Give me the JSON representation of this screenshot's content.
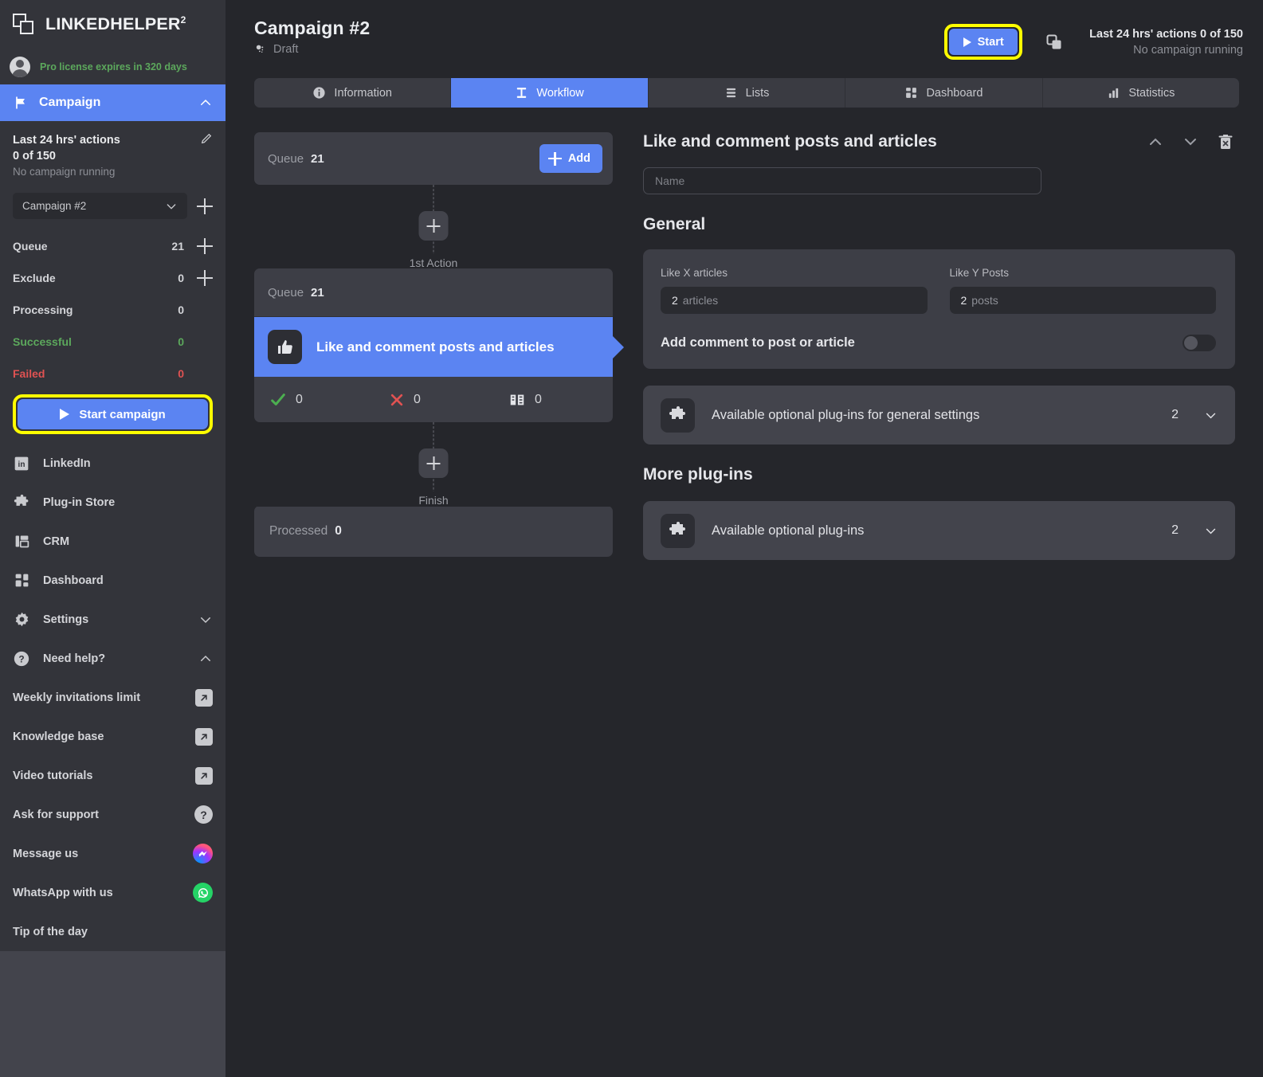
{
  "brand": {
    "name": "LINKEDHELPER",
    "sup": "2"
  },
  "license": {
    "text": "Pro license expires in 320 days",
    "color": "#5ca85c"
  },
  "sidebar": {
    "campaign_header": {
      "label": "Campaign",
      "icon": "flag-icon",
      "chevron": "chevron-up-icon"
    },
    "stats_header": {
      "title": "Last 24 hrs' actions",
      "value": "0 of 150",
      "subtitle": "No campaign running"
    },
    "campaign_select": {
      "value": "Campaign #2"
    },
    "counters": [
      {
        "label": "Queue",
        "value": "21",
        "has_add": true,
        "color": "default"
      },
      {
        "label": "Exclude",
        "value": "0",
        "has_add": true,
        "color": "default"
      },
      {
        "label": "Processing",
        "value": "0",
        "has_add": false,
        "color": "default"
      },
      {
        "label": "Successful",
        "value": "0",
        "has_add": false,
        "color": "green"
      },
      {
        "label": "Failed",
        "value": "0",
        "has_add": false,
        "color": "red"
      }
    ],
    "start_campaign_label": "Start campaign",
    "nav": [
      {
        "label": "LinkedIn",
        "icon": "linkedin-icon"
      },
      {
        "label": "Plug-in Store",
        "icon": "puzzle-icon"
      },
      {
        "label": "CRM",
        "icon": "crm-icon"
      },
      {
        "label": "Dashboard",
        "icon": "dashboard-icon"
      },
      {
        "label": "Settings",
        "icon": "gear-icon",
        "chevron": "chevron-down-icon"
      },
      {
        "label": "Need help?",
        "icon": "question-circle-icon",
        "chevron": "chevron-up-icon"
      }
    ],
    "links": [
      {
        "label": "Weekly invitations limit",
        "icon": "external-link-icon"
      },
      {
        "label": "Knowledge base",
        "icon": "external-link-icon"
      },
      {
        "label": "Video tutorials",
        "icon": "external-link-icon"
      },
      {
        "label": "Ask for support",
        "icon": "question-mark-icon"
      },
      {
        "label": "Message us",
        "icon": "messenger-icon"
      },
      {
        "label": "WhatsApp with us",
        "icon": "whatsapp-icon"
      },
      {
        "label": "Tip of the day",
        "icon": "none"
      }
    ]
  },
  "header": {
    "title": "Campaign #2",
    "status": "Draft",
    "status_icon": "draft-icon",
    "start_label": "Start",
    "copy_icon": "copy-icon",
    "actions_line1": "Last 24 hrs' actions 0 of 150",
    "actions_line2": "No campaign running",
    "highlight_color": "#ffff00",
    "accent_color": "#5b84f2"
  },
  "tabs": [
    {
      "label": "Information",
      "icon": "info-icon",
      "active": false
    },
    {
      "label": "Workflow",
      "icon": "workflow-icon",
      "active": true
    },
    {
      "label": "Lists",
      "icon": "list-icon",
      "active": false
    },
    {
      "label": "Dashboard",
      "icon": "dashboard-icon",
      "active": false
    },
    {
      "label": "Statistics",
      "icon": "bar-chart-icon",
      "active": false
    }
  ],
  "workflow": {
    "queue_card": {
      "label": "Queue",
      "value": "21",
      "add_label": "Add"
    },
    "connector_1_label": "1st Action",
    "connector_2_label": "Finish",
    "action": {
      "queue_label": "Queue",
      "queue_value": "21",
      "name": "Like and comment posts and articles",
      "icon": "thumbs-up-icon",
      "stats": [
        {
          "icon": "check-icon",
          "value": "0",
          "color": "#4caf50"
        },
        {
          "icon": "cross-icon",
          "value": "0",
          "color": "#e05252"
        },
        {
          "icon": "skipped-icon",
          "value": "0",
          "color": "#d4d5d9"
        }
      ]
    },
    "processed_card": {
      "label": "Processed",
      "value": "0"
    }
  },
  "settings": {
    "title": "Like and comment posts and articles",
    "move_up_icon": "chevron-up-icon",
    "move_down_icon": "chevron-down-icon",
    "delete_icon": "trash-icon",
    "name_placeholder": "Name",
    "name_value": "",
    "general_title": "General",
    "fields": [
      {
        "label": "Like X articles",
        "value": "2",
        "unit": "articles"
      },
      {
        "label": "Like Y Posts",
        "value": "2",
        "unit": "posts"
      }
    ],
    "toggle": {
      "label": "Add comment to post or article",
      "on": false
    },
    "plugin_general": {
      "label": "Available optional plug-ins for general settings",
      "count": "2",
      "icon": "puzzle-icon"
    },
    "more_plugins_title": "More plug-ins",
    "plugin_more": {
      "label": "Available optional plug-ins",
      "count": "2",
      "icon": "puzzle-icon"
    }
  }
}
